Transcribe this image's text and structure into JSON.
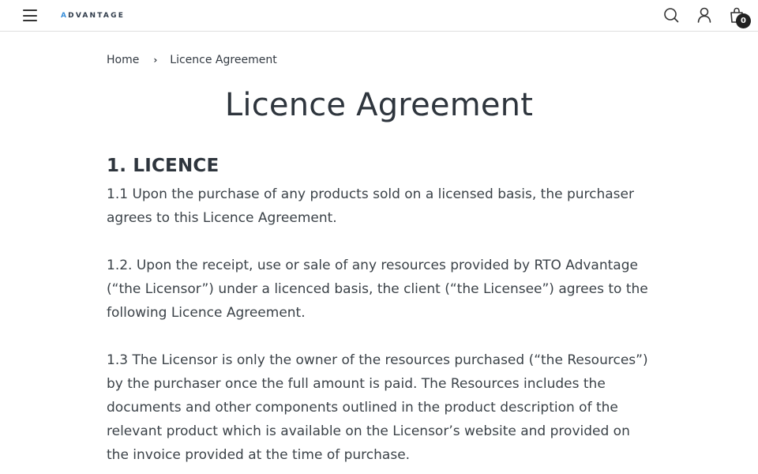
{
  "header": {
    "menu_icon": "hamburger-menu-icon",
    "logo_text": "ADVANTAGE",
    "logo_accent_color": "#3a8fd9",
    "search_icon": "search-icon",
    "account_icon": "user-icon",
    "cart_icon": "shopping-bag-icon",
    "cart_count": "0"
  },
  "breadcrumb": {
    "home": "Home",
    "separator": "›",
    "current": "Licence Agreement"
  },
  "page": {
    "title": "Licence Agreement"
  },
  "content": {
    "section_heading": "1. LICENCE",
    "paragraphs": [
      "1.1 Upon the purchase of any products sold on a licensed basis, the purchaser agrees to this Licence Agreement.",
      "1.2. Upon the receipt, use or sale of any resources provided by RTO Advantage (“the Licensor”) under a licenced basis, the client (“the Licensee”) agrees to the following Licence Agreement.",
      "1.3 The Licensor is only the owner of the resources purchased (“the Resources”) by the purchaser once the full amount is paid. The Resources includes the documents and other components outlined in the product description of the relevant product which is available on the Licensor’s website and provided on the invoice provided at the time of purchase."
    ]
  }
}
